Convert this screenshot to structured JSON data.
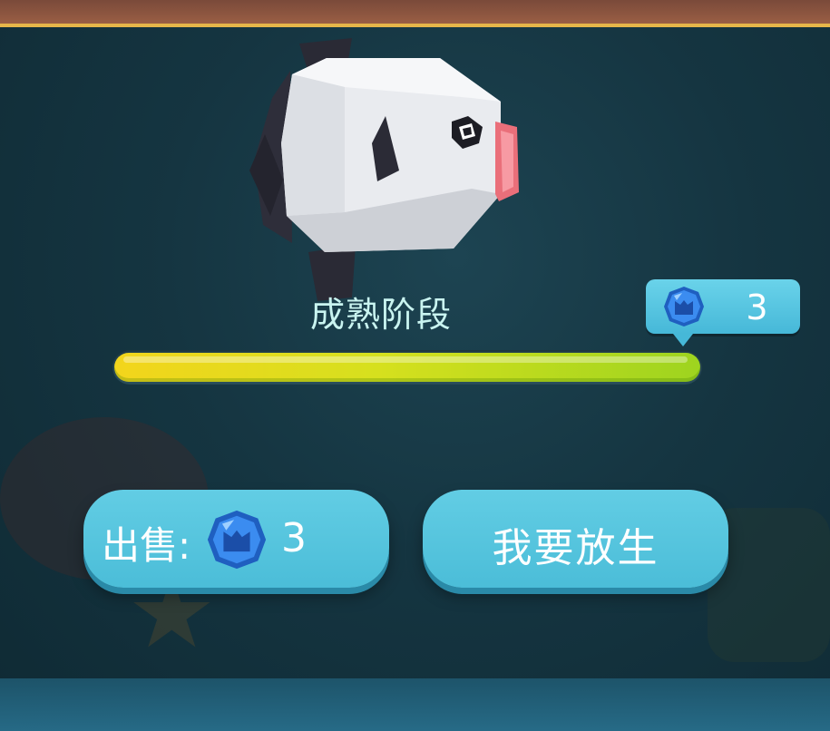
{
  "fish": {
    "icon": "sunfish-icon"
  },
  "growth": {
    "stage_label": "成熟阶段",
    "progress": 1.0,
    "reward_icon": "blue-gem-icon",
    "reward_value": "3"
  },
  "actions": {
    "sell_label": "出售:",
    "sell_price_icon": "blue-gem-icon",
    "sell_price": "3",
    "release_label": "我要放生"
  },
  "colors": {
    "button": "#55c4de",
    "progress_start": "#f3d51c",
    "progress_end": "#9ed41f",
    "gem": "#2f7fe6",
    "stage_text": "#c9f4f0"
  }
}
